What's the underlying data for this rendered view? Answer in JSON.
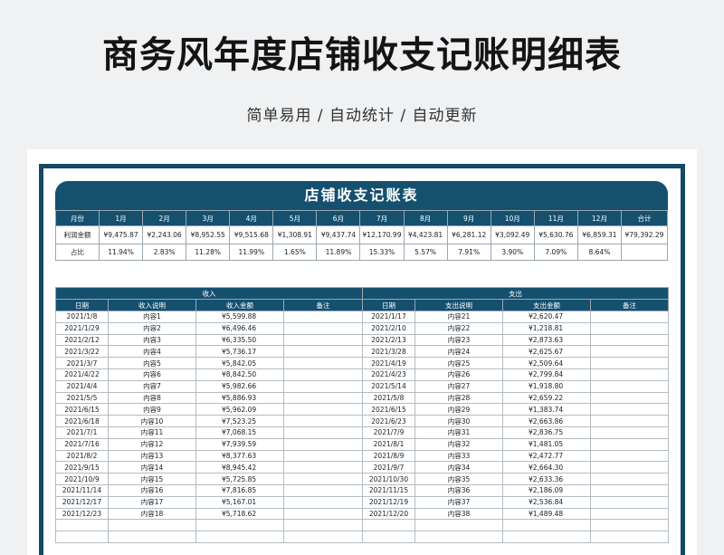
{
  "title": "商务风年度店铺收支记账明细表",
  "subtitle": "简单易用 / 自动统计 / 自动更新",
  "sheet_title": "店铺收支记账表",
  "summary": {
    "headers": [
      "月份",
      "1月",
      "2月",
      "3月",
      "4月",
      "5月",
      "6月",
      "7月",
      "8月",
      "9月",
      "10月",
      "11月",
      "12月",
      "合计"
    ],
    "profit": [
      "利润金额",
      "¥9,475.87",
      "¥2,243.06",
      "¥8,952.55",
      "¥9,515.68",
      "¥1,308.91",
      "¥9,437.74",
      "¥12,170.99",
      "¥4,423.81",
      "¥6,281.12",
      "¥3,092.49",
      "¥5,630.76",
      "¥6,859.31",
      "¥79,392.29"
    ],
    "ratio": [
      "占比",
      "11.94%",
      "2.83%",
      "11.28%",
      "11.99%",
      "1.65%",
      "11.89%",
      "15.33%",
      "5.57%",
      "7.91%",
      "3.90%",
      "7.09%",
      "8.64%",
      ""
    ]
  },
  "income": {
    "label": "收入",
    "columns": [
      "日期",
      "收入说明",
      "收入金额",
      "备注"
    ],
    "rows": [
      [
        "2021/1/8",
        "内容1",
        "¥5,599.88",
        ""
      ],
      [
        "2021/1/29",
        "内容2",
        "¥6,496.46",
        ""
      ],
      [
        "2021/2/12",
        "内容3",
        "¥6,335.50",
        ""
      ],
      [
        "2021/3/22",
        "内容4",
        "¥5,736.17",
        ""
      ],
      [
        "2021/3/7",
        "内容5",
        "¥5,842.05",
        ""
      ],
      [
        "2021/4/22",
        "内容6",
        "¥8,842.50",
        ""
      ],
      [
        "2021/4/4",
        "内容7",
        "¥5,982.66",
        ""
      ],
      [
        "2021/5/5",
        "内容8",
        "¥5,886.93",
        ""
      ],
      [
        "2021/6/15",
        "内容9",
        "¥5,962.09",
        ""
      ],
      [
        "2021/6/18",
        "内容10",
        "¥7,523.25",
        ""
      ],
      [
        "2021/7/1",
        "内容11",
        "¥7,068.15",
        ""
      ],
      [
        "2021/7/16",
        "内容12",
        "¥7,939.59",
        ""
      ],
      [
        "2021/8/2",
        "内容13",
        "¥8,377.63",
        ""
      ],
      [
        "2021/9/15",
        "内容14",
        "¥8,945.42",
        ""
      ],
      [
        "2021/10/9",
        "内容15",
        "¥5,725.85",
        ""
      ],
      [
        "2021/11/14",
        "内容16",
        "¥7,816.85",
        ""
      ],
      [
        "2021/12/17",
        "内容17",
        "¥5,167.01",
        ""
      ],
      [
        "2021/12/23",
        "内容18",
        "¥5,718.62",
        ""
      ],
      [
        "",
        "",
        "",
        ""
      ],
      [
        "",
        "",
        "",
        ""
      ]
    ]
  },
  "expense": {
    "label": "支出",
    "columns": [
      "日期",
      "支出说明",
      "支出金额",
      "备注"
    ],
    "rows": [
      [
        "2021/1/17",
        "内容21",
        "¥2,620.47",
        ""
      ],
      [
        "2021/2/10",
        "内容22",
        "¥1,218.81",
        ""
      ],
      [
        "2021/2/13",
        "内容23",
        "¥2,873.63",
        ""
      ],
      [
        "2021/3/28",
        "内容24",
        "¥2,625.67",
        ""
      ],
      [
        "2021/4/19",
        "内容25",
        "¥2,509.64",
        ""
      ],
      [
        "2021/4/23",
        "内容26",
        "¥2,799.84",
        ""
      ],
      [
        "2021/5/14",
        "内容27",
        "¥1,918.80",
        ""
      ],
      [
        "2021/5/8",
        "内容28",
        "¥2,659.22",
        ""
      ],
      [
        "2021/6/15",
        "内容29",
        "¥1,383.74",
        ""
      ],
      [
        "2021/6/23",
        "内容30",
        "¥2,663.86",
        ""
      ],
      [
        "2021/7/9",
        "内容31",
        "¥2,836.75",
        ""
      ],
      [
        "2021/8/1",
        "内容32",
        "¥1,481.05",
        ""
      ],
      [
        "2021/8/9",
        "内容33",
        "¥2,472.77",
        ""
      ],
      [
        "2021/9/7",
        "内容34",
        "¥2,664.30",
        ""
      ],
      [
        "2021/10/30",
        "内容35",
        "¥2,633.36",
        ""
      ],
      [
        "2021/11/15",
        "内容36",
        "¥2,186.09",
        ""
      ],
      [
        "2021/12/19",
        "内容37",
        "¥2,536.84",
        ""
      ],
      [
        "2021/12/20",
        "内容38",
        "¥1,489.48",
        ""
      ],
      [
        "",
        "",
        "",
        ""
      ],
      [
        "",
        "",
        "",
        ""
      ]
    ]
  }
}
